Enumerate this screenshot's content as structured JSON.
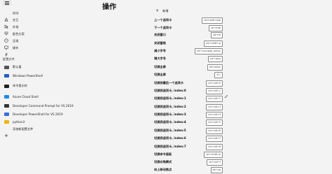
{
  "page_title": "操作",
  "sidebar": {
    "nav_items": [
      {
        "label": "启动",
        "icon": "rocket-icon"
      },
      {
        "label": "交互",
        "icon": "cursor-icon"
      },
      {
        "label": "外观",
        "icon": "paint-icon"
      },
      {
        "label": "配色方案",
        "icon": "palette-icon"
      },
      {
        "label": "呈现",
        "icon": "monitor-icon"
      },
      {
        "label": "操作",
        "icon": "lightning-icon"
      }
    ],
    "profiles_header": "配置文件",
    "profiles": [
      {
        "label": "默认值",
        "icon": "stack-icon",
        "color": "#555555"
      },
      {
        "label": "Windows PowerShell",
        "icon": "powershell-icon",
        "color": "#2a5cbf"
      },
      {
        "label": "命令提示符",
        "icon": "cmd-icon",
        "color": "#222222"
      },
      {
        "label": "Azure Cloud Shell",
        "icon": "azure-icon",
        "color": "#1e88e5"
      },
      {
        "label": "Developer Command Prompt for VS 2019",
        "icon": "vs-cmd-icon",
        "color": "#333333"
      },
      {
        "label": "Developer PowerShell for VS 2019",
        "icon": "vs-ps-icon",
        "color": "#3a6fd8"
      },
      {
        "label": "python3",
        "icon": "python-icon",
        "color": "#f0b400"
      },
      {
        "label": "添加新配置文件",
        "icon": "plus-icon",
        "color": "#333333"
      }
    ]
  },
  "main": {
    "add_new_label": "新增",
    "actions": [
      {
        "label": "上一个选项卡",
        "keys": "ctrl+shift+tab"
      },
      {
        "label": "下一个选项卡",
        "keys": "ctrl+tab"
      },
      {
        "label": "关闭窗口",
        "keys": "alt+f4"
      },
      {
        "label": "关闭窗格",
        "keys": "ctrl+shift+w"
      },
      {
        "label": "减小字号",
        "keys": "ctrl+numpad_minus"
      },
      {
        "label": "增大字号",
        "keys": "ctrl+plus"
      },
      {
        "label": "切换全屏",
        "keys": "alt+enter"
      },
      {
        "label": "切换全屏",
        "keys": "f11"
      },
      {
        "label": "切换到最后一个选项卡",
        "keys": "ctrl+alt+9"
      },
      {
        "label": "切换到选项卡, index:0",
        "keys": "ctrl+alt+1"
      },
      {
        "label": "切换到选项卡, index:1",
        "keys": "ctrl+alt+2"
      },
      {
        "label": "切换到选项卡, index:2",
        "keys": "ctrl+alt+3"
      },
      {
        "label": "切换到选项卡, index:3",
        "keys": "ctrl+alt+4"
      },
      {
        "label": "切换到选项卡, index:4",
        "keys": "ctrl+alt+5"
      },
      {
        "label": "切换到选项卡, index:5",
        "keys": "ctrl+alt+6"
      },
      {
        "label": "切换到选项卡, index:6",
        "keys": "ctrl+alt+7"
      },
      {
        "label": "切换到选项卡, index:7",
        "keys": "ctrl+alt+8"
      },
      {
        "label": "切换命令面板",
        "keys": "ctrl+shift+p"
      },
      {
        "label": "切换对焦模式",
        "keys": "ctrl+alt+f"
      },
      {
        "label": "向上移动焦点",
        "keys": "alt+up"
      }
    ]
  }
}
